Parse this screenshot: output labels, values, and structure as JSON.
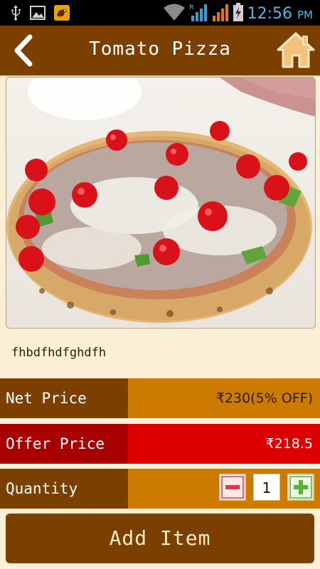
{
  "status_bar": {
    "time": "12:56",
    "ampm": "PM",
    "icons": [
      "usb-icon",
      "image-icon",
      "bird-app-icon",
      "wifi-icon",
      "signal-icon-1",
      "signal-icon-2",
      "battery-charging-icon"
    ],
    "roaming_marker": "R"
  },
  "header": {
    "title": "Tomato Pizza",
    "back_icon": "chevron-left-icon",
    "home_icon": "home-icon"
  },
  "product": {
    "image_alt": "pizza-photo",
    "description": "fhbdfhdfghdfh"
  },
  "net_price": {
    "label": "Net Price",
    "value": "₹230(5% OFF)"
  },
  "offer_price": {
    "label": "Offer Price",
    "value": "₹218.5"
  },
  "quantity": {
    "label": "Quantity",
    "value": "1",
    "decrement_icon": "minus-icon",
    "increment_icon": "plus-icon"
  },
  "actions": {
    "add_item_label": "Add Item"
  },
  "colors": {
    "header_bg": "#7b3f00",
    "value_bg": "#cc7a00",
    "offer_bg": "#dd0000",
    "page_bg": "#fbf0d6"
  }
}
